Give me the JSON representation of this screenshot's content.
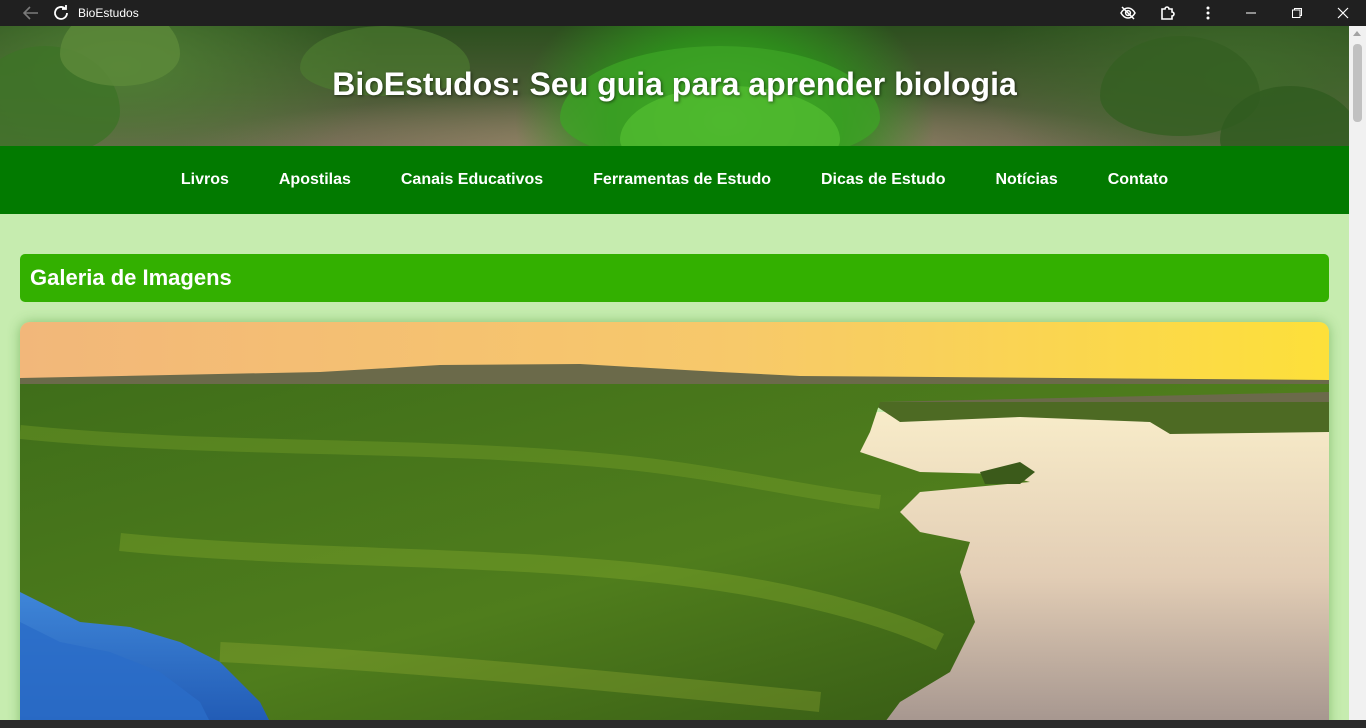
{
  "window": {
    "title": "BioEstudos",
    "icons": [
      "back-arrow-icon",
      "reload-icon",
      "eye-off-icon",
      "extensions-icon",
      "more-vertical-icon",
      "minimize-icon",
      "restore-icon",
      "close-icon"
    ]
  },
  "header": {
    "title": "BioEstudos: Seu guia para aprender biologia"
  },
  "nav": {
    "items": [
      {
        "label": "Livros"
      },
      {
        "label": "Apostilas"
      },
      {
        "label": "Canais Educativos"
      },
      {
        "label": "Ferramentas de Estudo"
      },
      {
        "label": "Dicas de Estudo"
      },
      {
        "label": "Notícias"
      },
      {
        "label": "Contato"
      }
    ]
  },
  "gallery": {
    "heading": "Galeria de Imagens"
  },
  "colors": {
    "page_background": "#c6ecaf",
    "nav_background": "#027a00",
    "heading_background": "#33b000",
    "text_on_green": "#ffffff"
  }
}
